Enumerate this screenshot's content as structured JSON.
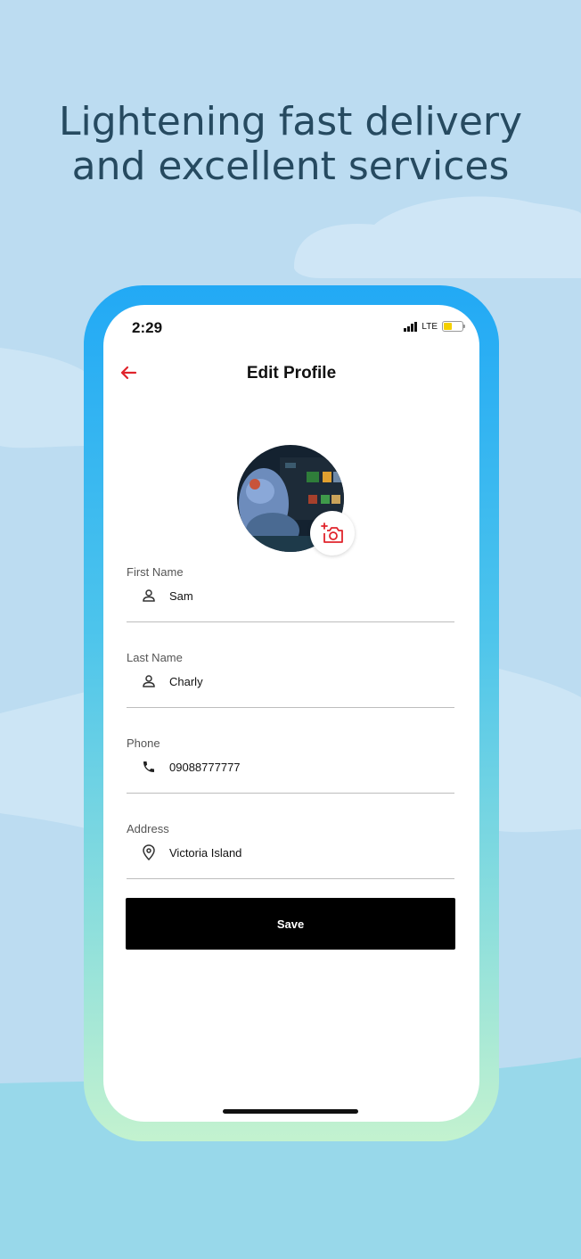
{
  "headline": {
    "line1": "Lightening fast delivery",
    "line2": "and excellent services"
  },
  "status_bar": {
    "time": "2:29",
    "network": "LTE",
    "battery_level": 0.45
  },
  "header": {
    "back_icon": "arrow-left-icon",
    "title": "Edit Profile"
  },
  "avatar": {
    "camera_icon": "add-photo-icon"
  },
  "form": {
    "fields": [
      {
        "label": "First Name",
        "value": "Sam",
        "icon": "user-icon"
      },
      {
        "label": "Last Name",
        "value": "Charly",
        "icon": "user-icon"
      },
      {
        "label": "Phone",
        "value": "09088777777",
        "icon": "phone-icon"
      },
      {
        "label": "Address",
        "value": "Victoria Island",
        "icon": "location-pin-icon"
      }
    ],
    "save_label": "Save"
  },
  "colors": {
    "accent": "#e0242c",
    "headline": "#264a60",
    "button": "#000000",
    "background": "#bcdcf1"
  }
}
